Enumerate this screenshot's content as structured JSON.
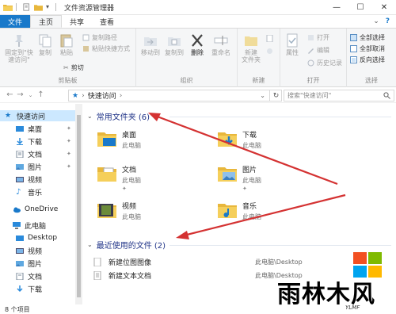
{
  "window": {
    "title": "文件资源管理器",
    "controls": [
      "minimize",
      "maximize",
      "close"
    ]
  },
  "menu": {
    "file": "文件",
    "tabs": [
      "主页",
      "共享",
      "查看"
    ]
  },
  "ribbon": {
    "clipboard": {
      "label": "剪贴板",
      "pin": "固定到\"快速访问\"",
      "copy": "复制",
      "paste": "粘贴",
      "copy_path": "复制路径",
      "paste_shortcut": "粘贴快捷方式",
      "cut": "剪切"
    },
    "organize": {
      "label": "组织",
      "move_to": "移动到",
      "copy_to": "复制到",
      "delete": "删除",
      "rename": "重命名"
    },
    "new": {
      "label": "新建",
      "new_folder": "新建\n文件夹"
    },
    "open": {
      "label": "打开",
      "properties": "属性",
      "open": "打开",
      "edit": "编辑",
      "history": "历史记录"
    },
    "select": {
      "label": "选择",
      "select_all": "全部选择",
      "select_none": "全部取消",
      "invert": "反向选择"
    }
  },
  "address": {
    "path": "快速访问",
    "search_placeholder": "搜索\"快速访问\""
  },
  "sidebar": {
    "items": [
      {
        "label": "快速访问",
        "icon": "star-icon",
        "selected": true
      },
      {
        "label": "桌面",
        "icon": "desktop-icon",
        "pinned": true
      },
      {
        "label": "下载",
        "icon": "download-icon",
        "pinned": true
      },
      {
        "label": "文档",
        "icon": "document-icon",
        "pinned": true
      },
      {
        "label": "图片",
        "icon": "picture-icon",
        "pinned": true
      },
      {
        "label": "视频",
        "icon": "video-icon"
      },
      {
        "label": "音乐",
        "icon": "music-icon"
      },
      {
        "label": "OneDrive",
        "icon": "cloud-icon"
      },
      {
        "label": "此电脑",
        "icon": "computer-icon"
      },
      {
        "label": "Desktop",
        "icon": "desktop-icon"
      },
      {
        "label": "视频",
        "icon": "video-icon"
      },
      {
        "label": "图片",
        "icon": "picture-icon"
      },
      {
        "label": "文档",
        "icon": "document-icon"
      },
      {
        "label": "下载",
        "icon": "download-icon"
      }
    ]
  },
  "frequent": {
    "header": "常用文件夹 (6)",
    "folders": [
      {
        "name": "桌面",
        "sub": "此电脑",
        "icon": "desktop-folder-icon",
        "pinned": false
      },
      {
        "name": "下载",
        "sub": "此电脑",
        "icon": "download-folder-icon",
        "pinned": false
      },
      {
        "name": "文档",
        "sub": "此电脑",
        "icon": "document-folder-icon",
        "pinned": true
      },
      {
        "name": "图片",
        "sub": "此电脑",
        "icon": "picture-folder-icon",
        "pinned": true
      },
      {
        "name": "视频",
        "sub": "此电脑",
        "icon": "video-folder-icon",
        "pinned": false
      },
      {
        "name": "音乐",
        "sub": "此电脑",
        "icon": "music-folder-icon",
        "pinned": false
      }
    ]
  },
  "recent": {
    "header": "最近使用的文件 (2)",
    "files": [
      {
        "name": "新建位图图像",
        "path": "此电脑\\Desktop"
      },
      {
        "name": "新建文本文档",
        "path": "此电脑\\Desktop"
      }
    ]
  },
  "status": {
    "count": "8 个项目"
  },
  "watermark": {
    "text": "雨林木风",
    "sub": "YLMF"
  },
  "colors": {
    "accent": "#1979ca",
    "selected": "#cce8ff",
    "section_header": "#1e3287",
    "arrow": "#d43232"
  }
}
